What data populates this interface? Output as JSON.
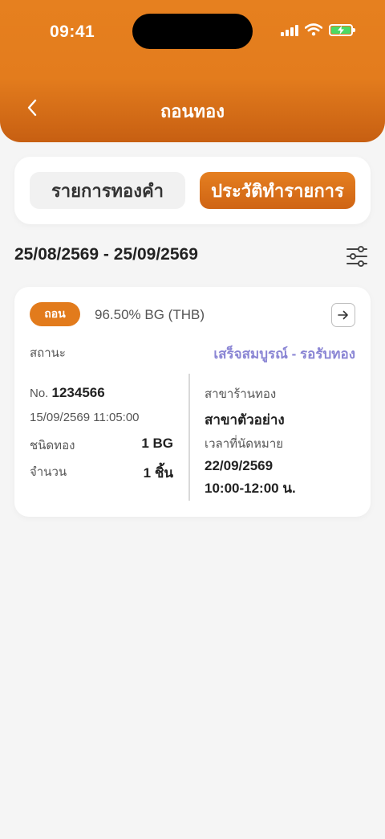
{
  "status_bar": {
    "time": "09:41"
  },
  "header": {
    "title": "ถอนทอง"
  },
  "tabs": [
    {
      "label": "รายการทองคำ",
      "active": false
    },
    {
      "label": "ประวัติทำรายการ",
      "active": true
    }
  ],
  "filter": {
    "date_range": "25/08/2569 - 25/09/2569"
  },
  "order": {
    "type_badge": "ถอน",
    "product": "96.50% BG (THB)",
    "status_label": "สถานะ",
    "status_value": "เสร็จสมบูรณ์ - รอรับทอง",
    "no_prefix": "No.",
    "no_value": "1234566",
    "datetime": "15/09/2569 11:05:00",
    "gold_type_label": "ชนิดทอง",
    "gold_type_value": "1 BG",
    "quantity_label": "จำนวน",
    "quantity_value": "1 ชิ้น",
    "branch_label": "สาขาร้านทอง",
    "branch_value": "สาขาตัวอย่าง",
    "appointment_label": "เวลาที่นัดหมาย",
    "appointment_date": "22/09/2569",
    "appointment_time": "10:00-12:00 น."
  },
  "colors": {
    "accent": "#e37c1d",
    "status": "#8a85d4",
    "background": "#f5f5f5"
  }
}
